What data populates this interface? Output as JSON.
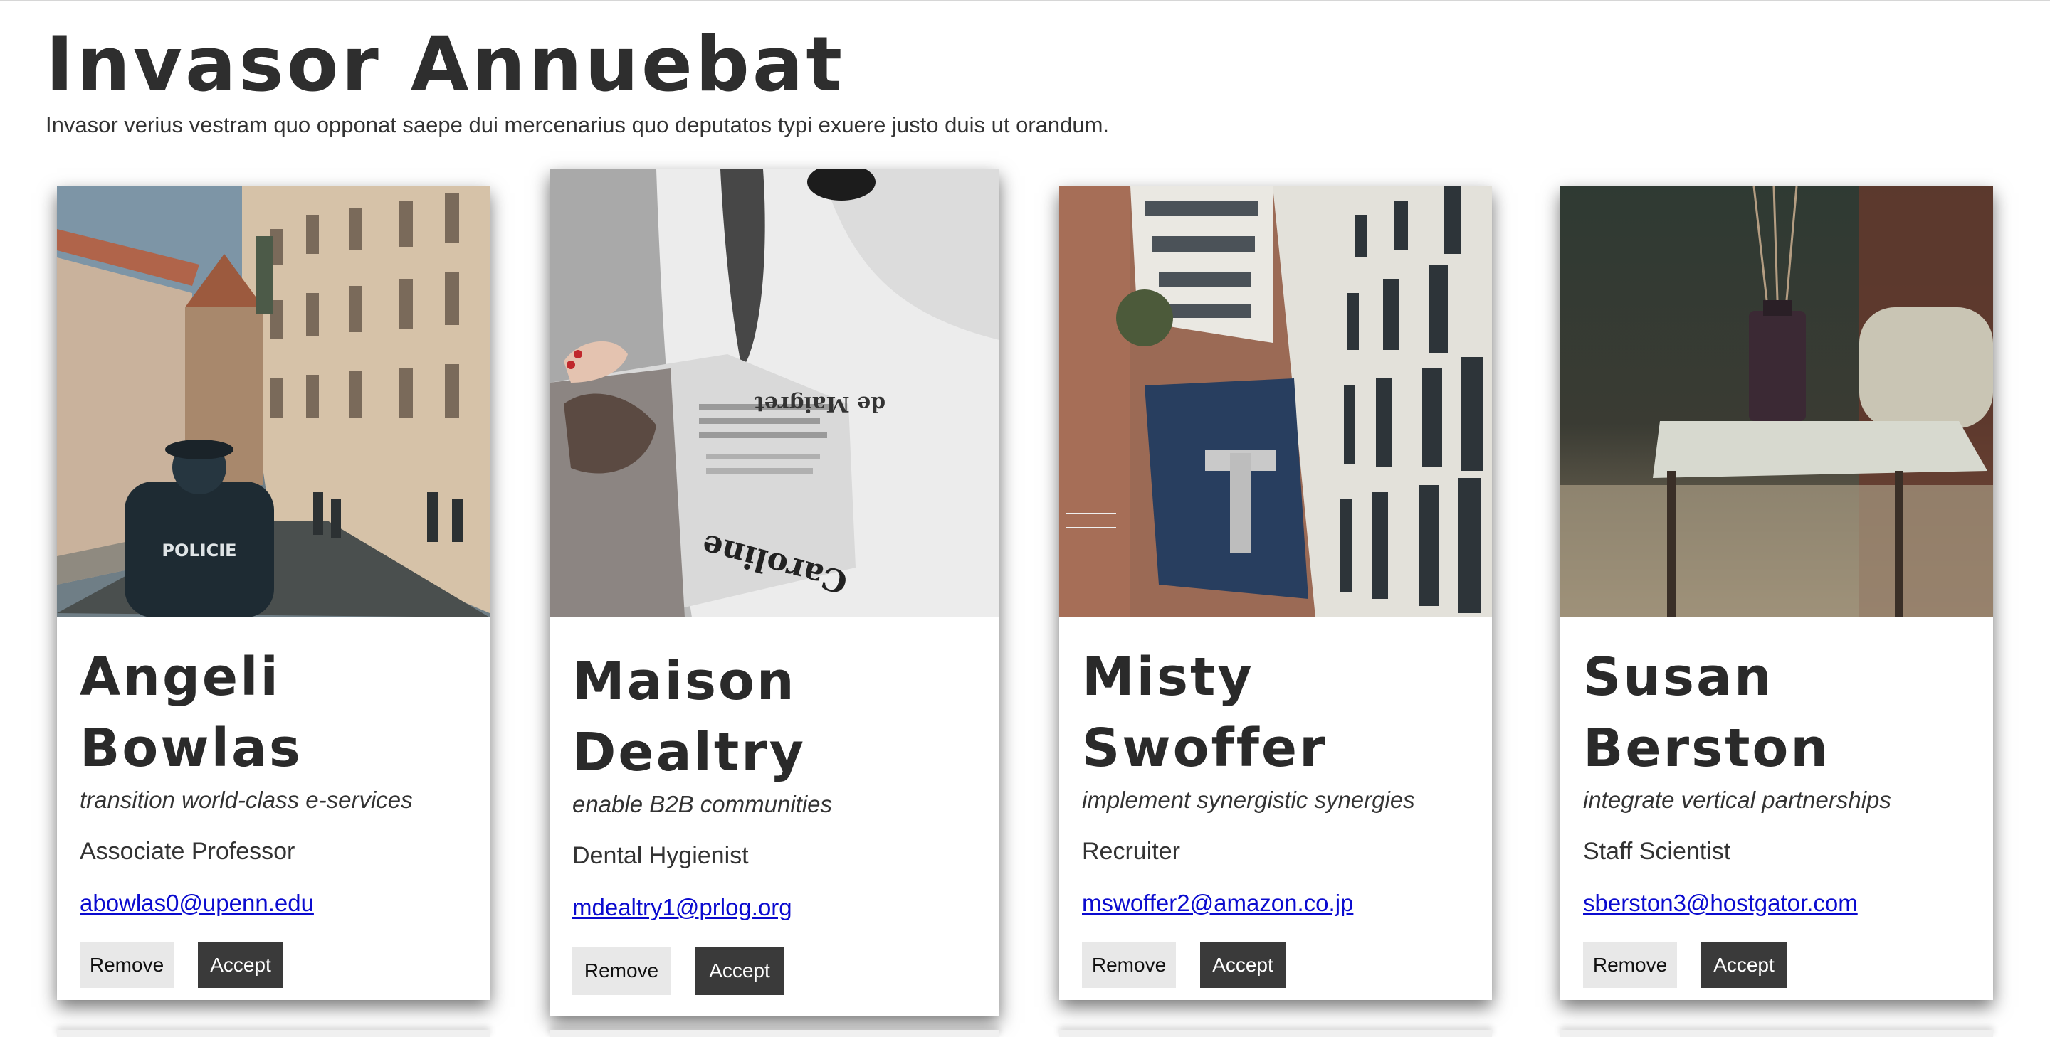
{
  "page": {
    "title": "Invasor Annuebat",
    "subtitle": "Invasor verius vestram quo opponat saepe dui mercenarius quo deputatos typi exuere justo duis ut orandum."
  },
  "cards": [
    {
      "name_first": "Angeli",
      "name_last": "Bowlas",
      "tagline": "transition world-class e-services",
      "job": "Associate Professor",
      "email": "abowlas0@upenn.edu",
      "remove_label": "Remove",
      "accept_label": "Accept"
    },
    {
      "name_first": "Maison",
      "name_last": "Dealtry",
      "tagline": "enable B2B communities",
      "job": "Dental Hygienist",
      "email": "mdealtry1@prlog.org",
      "remove_label": "Remove",
      "accept_label": "Accept"
    },
    {
      "name_first": "Misty",
      "name_last": "Swoffer",
      "tagline": "implement synergistic synergies",
      "job": "Recruiter",
      "email": "mswoffer2@amazon.co.jp",
      "remove_label": "Remove",
      "accept_label": "Accept"
    },
    {
      "name_first": "Susan",
      "name_last": "Berston",
      "tagline": "integrate vertical partnerships",
      "job": "Staff Scientist",
      "email": "sberston3@hostgator.com",
      "remove_label": "Remove",
      "accept_label": "Accept"
    }
  ],
  "photo_text": {
    "police_jacket": "POLICIE",
    "newspaper_top": "de Maigret",
    "newspaper_bottom": "Caroline"
  },
  "colors": {
    "accept_button": "#3a3a3a",
    "remove_button": "#e8e8e8",
    "link": "#0b0bcf",
    "heading": "#2e2e2e"
  }
}
